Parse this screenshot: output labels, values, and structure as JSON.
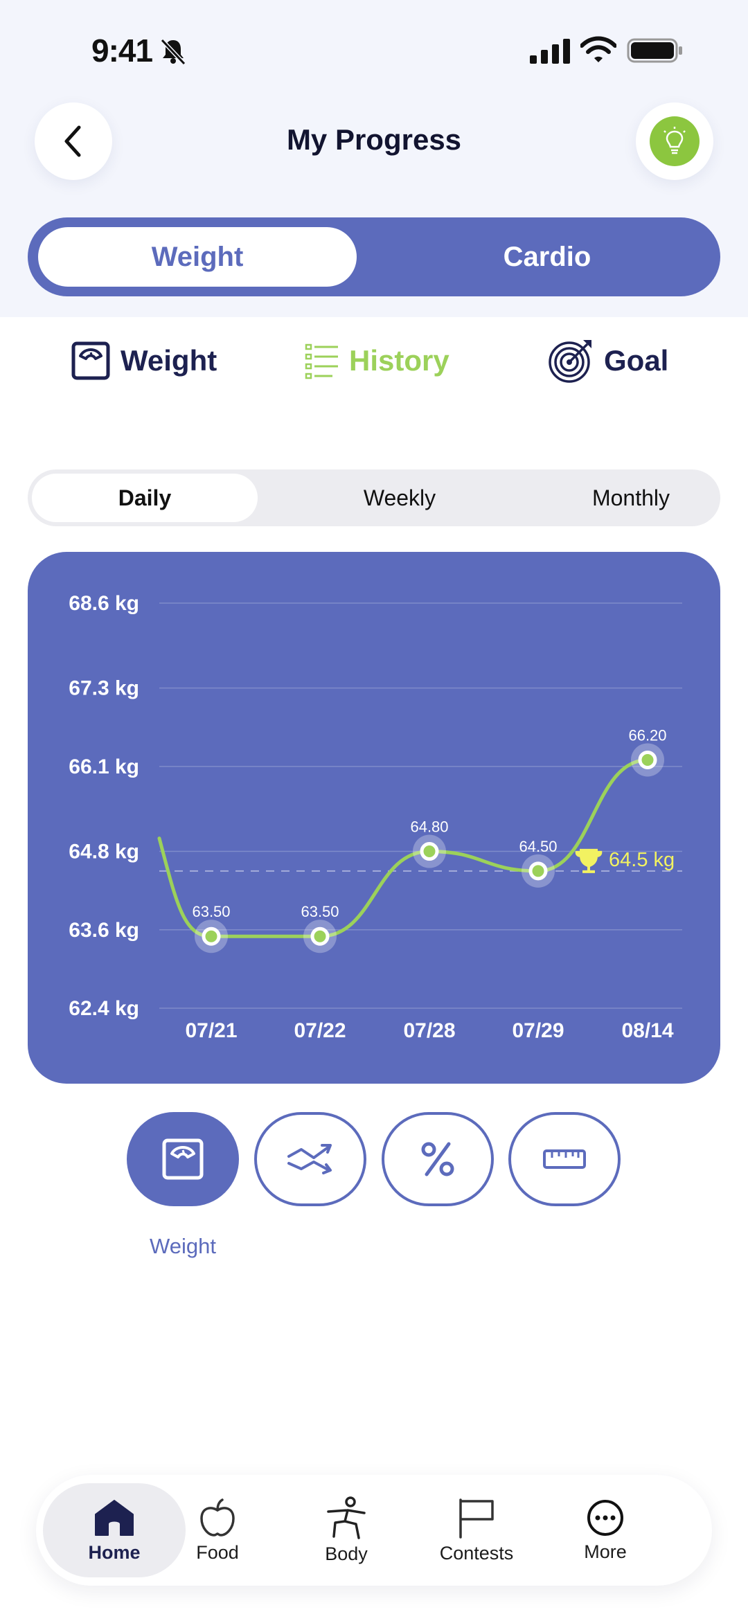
{
  "status_bar": {
    "time": "9:41"
  },
  "header": {
    "title": "My Progress"
  },
  "main_segment": {
    "items": [
      "Weight",
      "Cardio"
    ],
    "selected": "Weight"
  },
  "sub_tabs": [
    {
      "label": "Weight",
      "icon": "scale-icon"
    },
    {
      "label": "History",
      "icon": "list-icon",
      "active": true
    },
    {
      "label": "Goal",
      "icon": "target-icon"
    }
  ],
  "period": {
    "items": [
      "Daily",
      "Weekly",
      "Monthly"
    ],
    "selected": "Daily"
  },
  "chart_data": {
    "type": "line",
    "categories": [
      "07/21",
      "07/22",
      "07/28",
      "07/29",
      "08/14"
    ],
    "values": [
      63.5,
      63.5,
      64.8,
      64.5,
      66.2
    ],
    "data_labels": [
      "63.50",
      "63.50",
      "64.80",
      "64.50",
      "66.20"
    ],
    "y_ticks": [
      "68.6 kg",
      "67.3 kg",
      "66.1 kg",
      "64.8 kg",
      "63.6 kg",
      "62.4 kg"
    ],
    "y_tick_values": [
      68.6,
      67.3,
      66.1,
      64.8,
      63.6,
      62.4
    ],
    "ylim": [
      62.4,
      68.6
    ],
    "goal": {
      "value": 64.5,
      "label": "64.5 kg"
    },
    "line_color": "#9cd15a",
    "background_color": "#5c6bbc",
    "grid": true
  },
  "metric_buttons": {
    "items": [
      "scale-icon",
      "trend-icon",
      "percent-icon",
      "ruler-icon"
    ],
    "selected_label": "Weight"
  },
  "bottom_nav": {
    "items": [
      {
        "label": "Home",
        "icon": "home-icon",
        "active": true
      },
      {
        "label": "Food",
        "icon": "apple-icon"
      },
      {
        "label": "Body",
        "icon": "body-icon"
      },
      {
        "label": "Contests",
        "icon": "flag-icon"
      },
      {
        "label": "More",
        "icon": "more-icon"
      }
    ]
  },
  "colors": {
    "accent": "#5c6bbc",
    "green": "#9cd15a",
    "goal": "#f2f261"
  }
}
